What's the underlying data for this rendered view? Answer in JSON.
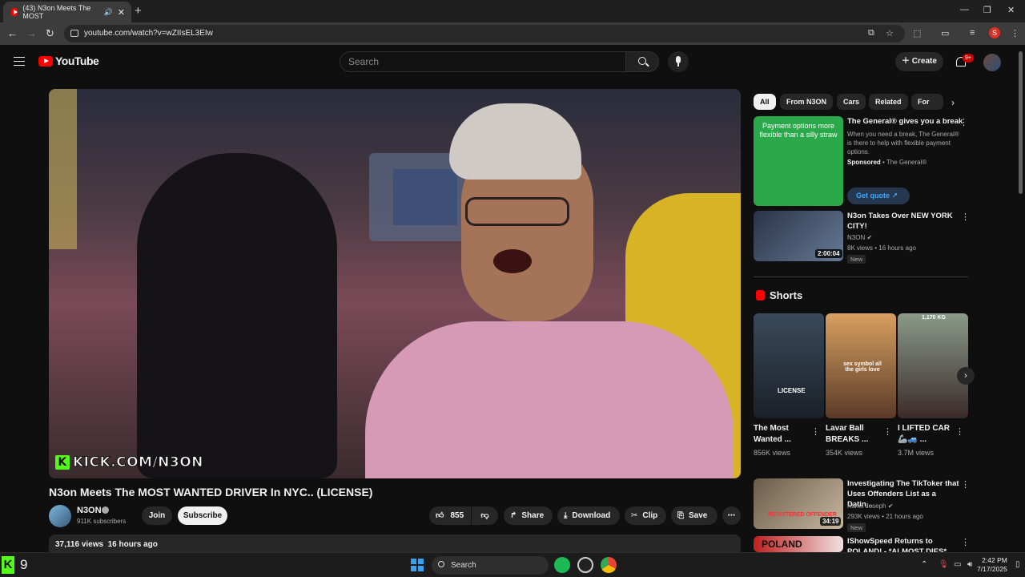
{
  "browser": {
    "tab_title": "(43) N3on Meets The MOST",
    "tab_close": "✕",
    "new_tab": "+",
    "url": "youtube.com/watch?v=wZIIsEL3EIw",
    "profile_initial": "S",
    "window_controls": [
      "—",
      "❐",
      "✕"
    ]
  },
  "yt_header": {
    "logo_text": "YouTube",
    "search_placeholder": "Search",
    "create_label": "Create",
    "notification_badge": "9+"
  },
  "player": {
    "overlay_text": "KICK.COM/N3ON",
    "overlay_logo": "K"
  },
  "video": {
    "title": "N3on Meets The MOST WANTED DRIVER In NYC.. (LICENSE)",
    "channel_name": "N3ON",
    "subscribers": "911K subscribers",
    "join_label": "Join",
    "subscribe_label": "Subscribe",
    "likes": "855",
    "share_label": "Share",
    "download_label": "Download",
    "clip_label": "Clip",
    "save_label": "Save",
    "views": "37,116 views",
    "time_ago": "16 hours ago"
  },
  "sidebar": {
    "chips": [
      "All",
      "From N3ON",
      "Cars",
      "Related",
      "For yo"
    ],
    "ad": {
      "thumb_text": "Payment options more flexible than a silly straw",
      "title": "The General® gives you a break",
      "desc": "When you need a break, The General® is there to help with flexible payment options.",
      "sponsored": "Sponsored",
      "advertiser": "The General®",
      "cta": "Get quote"
    },
    "rec1": {
      "title": "N3on Takes Over NEW YORK CITY!",
      "channel": "N3ON",
      "meta": "8K views • 16 hours ago",
      "badge": "New",
      "duration": "2:00:04"
    },
    "shorts_title": "Shorts",
    "shorts": [
      {
        "title": "The Most Wanted ...",
        "views": "856K views",
        "overlay": "LICENSE"
      },
      {
        "title": "Lavar Ball BREAKS ...",
        "views": "354K views",
        "overlay": "sex symbol all the girls love"
      },
      {
        "title": "I LIFTED CAR 🦾🚙 ...",
        "views": "3.7M views",
        "overlay": "1,170 KG"
      }
    ],
    "rec2": {
      "title": "Investigating The TikToker that Uses Offenders List as a Datin...",
      "channel": "Kanel Joseph",
      "meta": "293K views • 21 hours ago",
      "badge": "New",
      "duration": "34:19",
      "thumb_text": "REGISTERED OFFENDER"
    },
    "rec3": {
      "title": "IShowSpeed Returns to POLAND! - *ALMOST DIES*",
      "thumb_text": "POLAND"
    }
  },
  "taskbar": {
    "widget_logo": "K",
    "widget_count": "9",
    "search_label": "Search",
    "time": "2:42 PM",
    "date": "7/17/2025"
  },
  "colors": {
    "accent": "#ff0000",
    "background": "#0f0f0f",
    "chip_bg": "#272727",
    "link_blue": "#3ea6ff",
    "kick_green": "#53fc18"
  }
}
